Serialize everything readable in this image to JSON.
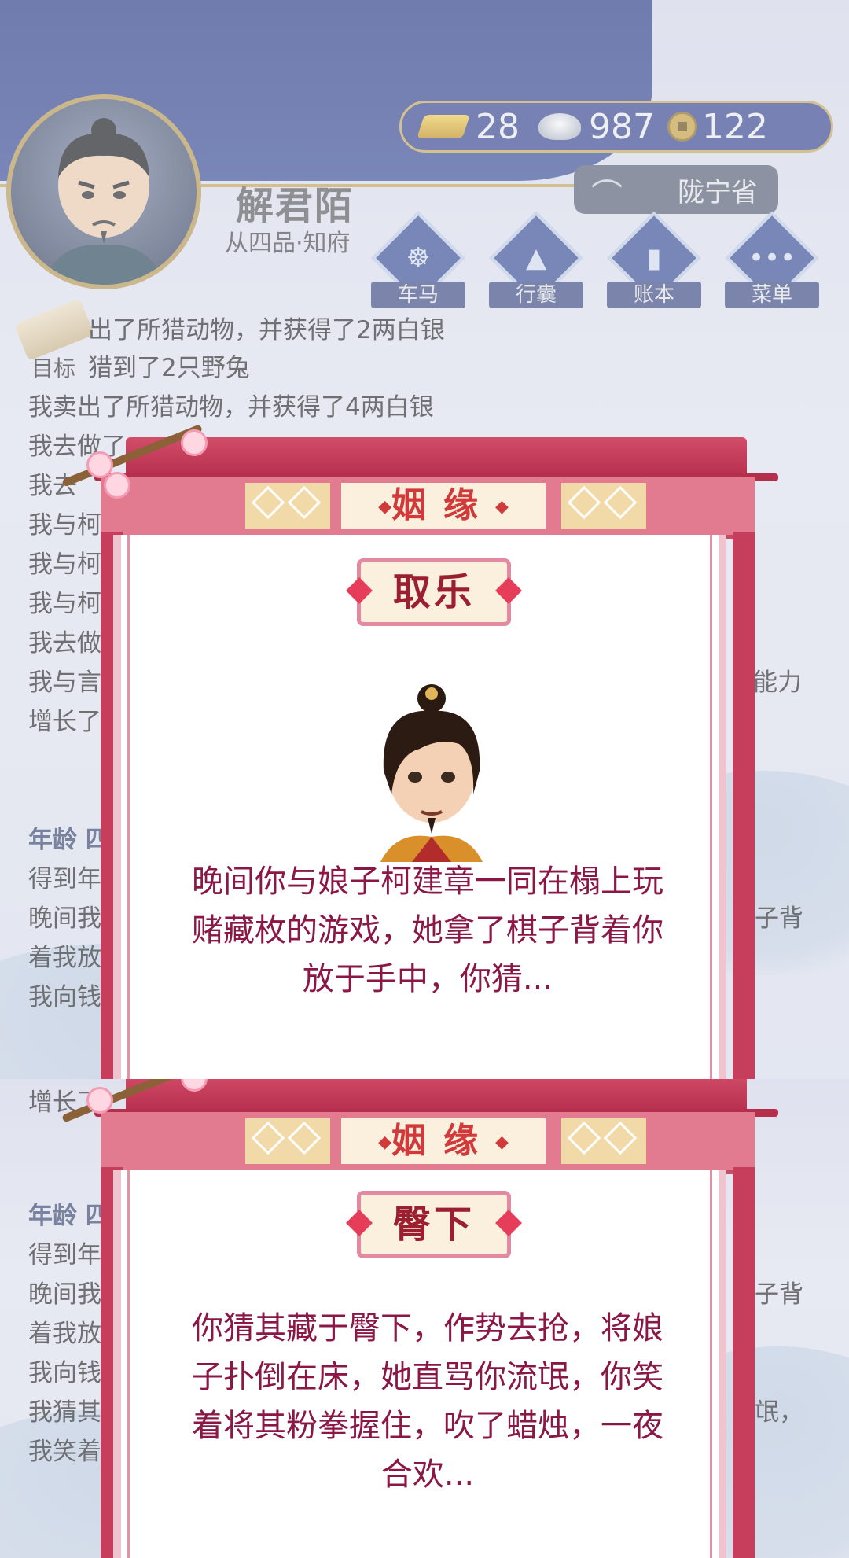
{
  "player": {
    "name": "解君陌",
    "rank": "从四品·知府"
  },
  "currency": {
    "gold": "28",
    "silver": "987",
    "coins": "122"
  },
  "location": "陇宁省",
  "menu": [
    {
      "label": "车马",
      "icon": "carriage-icon"
    },
    {
      "label": "行囊",
      "icon": "bag-icon"
    },
    {
      "label": "账本",
      "icon": "ledger-icon"
    },
    {
      "label": "菜单",
      "icon": "more-icon"
    }
  ],
  "goal_label": "目标",
  "log_top": [
    "出了所猎动物，并获得了2两白银",
    "猎到了2只野兔",
    "我卖出了所猎动物，并获得了4两白银",
    "我去做了",
    "我去",
    "我与柯",
    "我与柯",
    "我与柯",
    "我去做",
    "我与言",
    "增长了"
  ],
  "log_top_right": {
    "line9": "能力"
  },
  "log_section1": [
    "年龄 四",
    "得到年",
    "晚间我",
    "着我放",
    "我向钱"
  ],
  "log_section1_right": {
    "line2": "子背"
  },
  "log_bottom_first": "增长了",
  "log_section2": [
    "年龄 四",
    "得到年",
    "晚间我",
    "着我放",
    "我向钱",
    "我猜其",
    "我笑着"
  ],
  "log_section2_right": {
    "line2": "子背",
    "line5": "氓，"
  },
  "panel1": {
    "header": "姻缘",
    "choice": "取乐",
    "story_lines": [
      "晚间你与娘子柯建章一同在榻上玩",
      "赌藏枚的游戏，她拿了棋子背着你",
      "放于手中，你猜..."
    ]
  },
  "panel2": {
    "header": "姻缘",
    "choice": "臀下",
    "story_lines": [
      "你猜其藏于臀下，作势去抢，将娘",
      "子扑倒在床，她直骂你流氓，你笑",
      "着将其粉拳握住，吹了蜡烛，一夜",
      "合欢..."
    ]
  },
  "colors": {
    "header_blue": "#3d4f97",
    "panel_red": "#c73d5c",
    "story_text": "#8a1746",
    "gold_border": "#c7a657"
  }
}
